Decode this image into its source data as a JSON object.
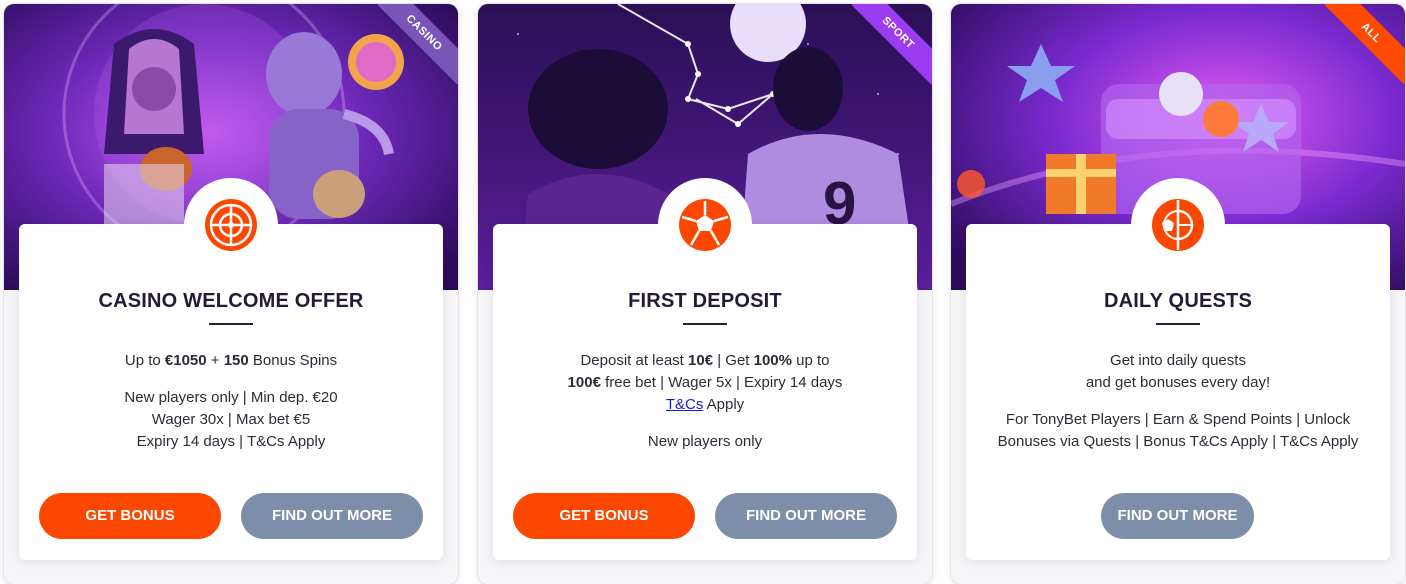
{
  "colors": {
    "accent_orange": "#fc4700",
    "secondary_grey": "#7d8ea8",
    "title_dark": "#241a38",
    "ribbon_casino": "#7a55b8",
    "ribbon_sport": "#9b3cf0",
    "ribbon_all": "#ff4a00"
  },
  "cards": [
    {
      "ribbon": "CASINO",
      "icon": "roulette-icon",
      "title": "CASINO WELCOME OFFER",
      "line1": {
        "pre": "Up to ",
        "b1": "€1050",
        "mid": " + ",
        "b2": "150",
        "post": " Bonus Spins"
      },
      "terms": [
        "New players only | Min dep. €20",
        "Wager 30x | Max bet €5",
        "Expiry 14 days | T&Cs Apply"
      ],
      "buttons": {
        "primary": "GET BONUS",
        "secondary": "FIND OUT MORE"
      }
    },
    {
      "ribbon": "SPORT",
      "icon": "soccer-ball-icon",
      "title": "FIRST DEPOSIT",
      "line1": {
        "a": "Deposit at least ",
        "b1": "10€",
        "c": " | Get ",
        "b2": "100%",
        "d": " up to"
      },
      "line2": {
        "b1": "100€",
        "a": " free bet | Wager 5x | Expiry 14 days"
      },
      "line3": {
        "link": "T&Cs",
        "a": " Apply"
      },
      "extra": "New players only",
      "buttons": {
        "primary": "GET BONUS",
        "secondary": "FIND OUT MORE"
      }
    },
    {
      "ribbon": "ALL",
      "icon": "ball-and-roulette-icon",
      "title": "DAILY QUESTS",
      "intro": [
        "Get into daily quests",
        "and get bonuses every day!"
      ],
      "terms": [
        "For TonyBet Players | Earn & Spend Points | Unlock",
        "Bonuses via Quests | Bonus T&Cs Apply | T&Cs Apply"
      ],
      "buttons": {
        "secondary": "FIND OUT MORE"
      }
    }
  ]
}
